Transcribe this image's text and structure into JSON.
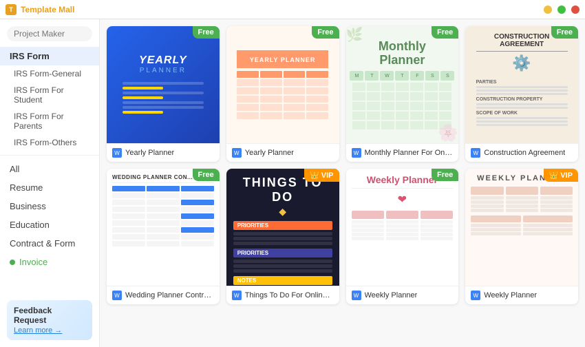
{
  "titleBar": {
    "appName": "Template Mall",
    "minimize": "−",
    "maximize": "□",
    "close": "×"
  },
  "search": {
    "placeholder": "Project Maker"
  },
  "sidebar": {
    "activeSection": "IRS Form",
    "subItems": [
      {
        "label": "IRS Form-General"
      },
      {
        "label": "IRS Form For Student"
      },
      {
        "label": "IRS Form For Parents"
      },
      {
        "label": "IRS Form-Others"
      }
    ],
    "allLabel": "All",
    "mainItems": [
      {
        "label": "Resume",
        "icon": false
      },
      {
        "label": "Business",
        "icon": false
      },
      {
        "label": "Education",
        "icon": false
      },
      {
        "label": "Contract & Form",
        "icon": false
      },
      {
        "label": "Invoice",
        "icon": true
      }
    ],
    "feedback": {
      "title": "Feedback Request",
      "linkText": "Learn more →"
    }
  },
  "cards": [
    {
      "id": "yearly-1",
      "badge": "Free",
      "badgeType": "free",
      "title": "Yearly Planner",
      "template": "yearly-1"
    },
    {
      "id": "yearly-2",
      "badge": "Free",
      "badgeType": "free",
      "title": "Yearly Planner",
      "template": "yearly-2"
    },
    {
      "id": "monthly-1",
      "badge": "Free",
      "badgeType": "free",
      "title": "Monthly Planner For Onlin...",
      "template": "monthly"
    },
    {
      "id": "construction-1",
      "badge": "Free",
      "badgeType": "free",
      "title": "Construction Agreement",
      "template": "construction"
    },
    {
      "id": "wedding-1",
      "badge": "Free",
      "badgeType": "free",
      "title": "Wedding Planner Contract",
      "template": "wedding"
    },
    {
      "id": "todo-1",
      "badge": "VIP",
      "badgeType": "vip",
      "title": "Things To Do For Online Pl...",
      "template": "todo"
    },
    {
      "id": "weekly-free",
      "badge": "Free",
      "badgeType": "free",
      "title": "Weekly Planner",
      "template": "weekly-free"
    },
    {
      "id": "weekly-vip",
      "badge": "VIP",
      "badgeType": "vip",
      "title": "Weekly Planner",
      "template": "weekly-vip"
    }
  ],
  "days": [
    "Mon",
    "Tue",
    "Wed",
    "Thu",
    "Fri",
    "Sat",
    "Sun"
  ],
  "monthlyTitle": "Monthly\nPlanner"
}
